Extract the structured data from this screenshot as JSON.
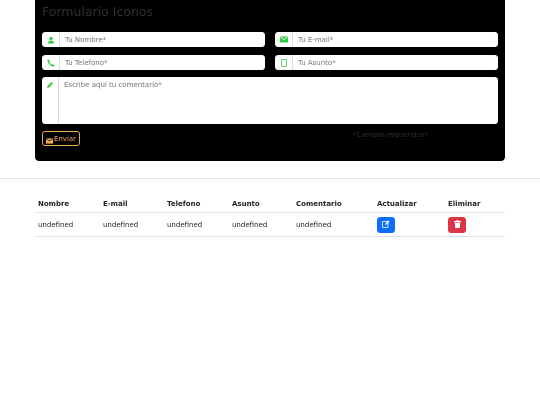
{
  "form": {
    "title": "Formulario Iconos",
    "name_placeholder": "Tu Nombre*",
    "email_placeholder": "Tu E-mail*",
    "phone_placeholder": "Tu Telefono*",
    "subject_placeholder": "Tu Asunto*",
    "comment_placeholder": "Escribe aquí tu comentario*",
    "submit_label": "Enviar",
    "required_note": "*Campos requeridos*"
  },
  "icons": {
    "name": "user-icon",
    "email": "envelope-icon",
    "phone": "phone-icon",
    "subject": "document-icon",
    "comment": "pencil-icon",
    "submit": "envelope-icon",
    "update": "edit-icon",
    "delete": "trash-icon"
  },
  "colors": {
    "form_background": "#000000",
    "icon_green": "#2ecc40",
    "submit_accent": "#f0ad4e",
    "update_button": "#0d6efd",
    "delete_button": "#dc3545"
  },
  "table": {
    "headers": [
      "Nombre",
      "E-mail",
      "Telefono",
      "Asunto",
      "Comentario",
      "Actualizar",
      "Eliminar"
    ],
    "rows": [
      {
        "nombre": "undefined",
        "email": "undefined",
        "telefono": "undefined",
        "asunto": "undefined",
        "comentario": "undefined"
      }
    ]
  }
}
